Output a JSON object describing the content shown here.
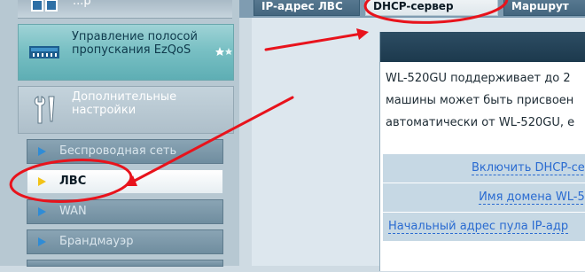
{
  "sidebar": {
    "top_item": {
      "label": "...р",
      "icon": "network-map-icon"
    },
    "qos": {
      "label": "Управление полосой пропускания EzQoS",
      "icon": "qos-bandwidth-icon"
    },
    "advanced": {
      "label": "Дополнительные настройки",
      "icon": "tools-icon"
    },
    "menu": [
      {
        "label": "Беспроводная сеть",
        "active": false
      },
      {
        "label": "ЛВС",
        "active": true
      },
      {
        "label": "WAN",
        "active": false
      },
      {
        "label": "Брандмауэр",
        "active": false
      }
    ]
  },
  "tabs": [
    {
      "label": "IP-адрес ЛВС",
      "active": false
    },
    {
      "label": "DHCP-сервер",
      "active": true
    },
    {
      "label": "Маршрут",
      "active": false
    }
  ],
  "main": {
    "description": [
      "WL-520GU поддерживает до 2",
      "машины может быть присвоен",
      "автоматически от WL-520GU, е"
    ],
    "fields": [
      {
        "label": "Включить DHCP-сер"
      },
      {
        "label": "Имя домена WL-52"
      },
      {
        "label": "Начальный адрес пула IP-адр"
      }
    ]
  },
  "colors": {
    "annotation": "#e8131c",
    "active_marker": "#f2c318",
    "link": "#2a6bd1"
  }
}
